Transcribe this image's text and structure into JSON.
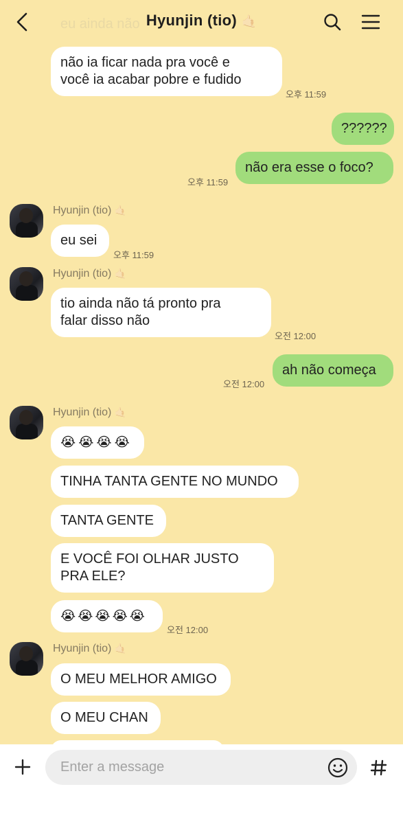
{
  "header": {
    "title": "Hyunjin (tio)",
    "title_emoji": "🤙🏻",
    "ghost_text": "eu ainda não"
  },
  "messages": [
    {
      "text": "não ia ficar nada pra você e\nvocê ia acabar pobre e fudido",
      "time": "오후 11:59"
    },
    {
      "text": "??????"
    },
    {
      "text": "não era esse o foco?",
      "time": "오후 11:59"
    },
    {
      "sender": "Hyunjin (tio)",
      "text": "eu sei",
      "time": "오후 11:59"
    },
    {
      "sender": "Hyunjin (tio)",
      "text": "tio ainda não tá pronto pra\nfalar disso não",
      "time": "오전 12:00"
    },
    {
      "text": "ah não começa",
      "time": "오전 12:00"
    },
    {
      "sender": "Hyunjin (tio)",
      "text": "😭😭😭😭"
    },
    {
      "text": "TINHA TANTA GENTE NO MUNDO"
    },
    {
      "text": "TANTA GENTE"
    },
    {
      "text": "E VOCÊ FOI OLHAR JUSTO\nPRA ELE?"
    },
    {
      "text": "😭😭😭😭😭",
      "time": "오전 12:00"
    },
    {
      "sender": "Hyunjin (tio)",
      "text": "O MEU MELHOR AMIGO"
    },
    {
      "text": "O MEU CHAN"
    }
  ],
  "sender_emoji": "🤙🏻",
  "composer": {
    "placeholder": "Enter a message"
  },
  "colors": {
    "background": "#fae7a7",
    "my_bubble": "#a1dc7c",
    "their_bubble": "#ffffff"
  },
  "icons": [
    "back-arrow-icon",
    "search-icon",
    "menu-icon",
    "plus-icon",
    "emoji-icon",
    "hashtag-icon"
  ]
}
